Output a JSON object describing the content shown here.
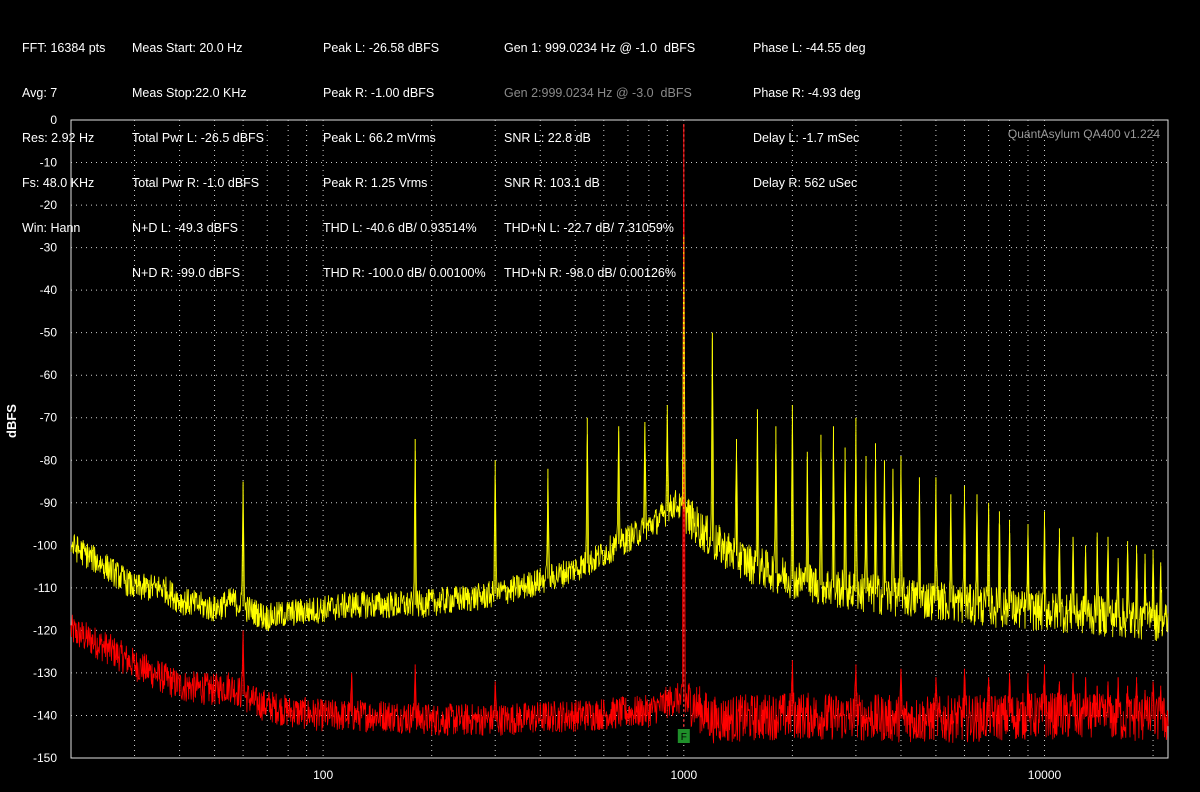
{
  "stats": {
    "col1": [
      "FFT: 16384 pts",
      "Avg: 7",
      "Res: 2.92 Hz",
      "Fs: 48.0 KHz",
      "Win: Hann"
    ],
    "col2": [
      "Meas Start: 20.0 Hz",
      "Meas Stop:22.0 KHz",
      "Total Pwr L: -26.5 dBFS",
      "Total Pwr R: -1.0 dBFS",
      "N+D L: -49.3 dBFS",
      "N+D R: -99.0 dBFS"
    ],
    "col3": [
      "Peak L: -26.58 dBFS",
      "Peak R: -1.00 dBFS",
      "Peak L: 66.2 mVrms",
      "Peak R: 1.25 Vrms",
      "THD L: -40.6 dB/ 0.93514%",
      "THD R: -100.0 dB/ 0.00100%"
    ],
    "col4_gen1": "Gen 1: 999.0234 Hz @ -1.0  dBFS",
    "col4_gen2": "Gen 2:999.0234 Hz @ -3.0  dBFS",
    "col4": [
      "SNR L: 22.8 dB",
      "SNR R: 103.1 dB",
      "THD+N L: -22.7 dB/ 7.31059%",
      "THD+N R: -98.0 dB/ 0.00126%"
    ],
    "col5": [
      "Phase L: -44.55 deg",
      "Phase R: -4.93 deg",
      "Delay L: -1.7 mSec",
      "Delay R: 562 uSec"
    ]
  },
  "chart_data": {
    "type": "line",
    "title": "",
    "watermark": "QuantAsylum QA400 v1.224",
    "xlabel": "",
    "ylabel": "dBFS",
    "x_scale": "log",
    "xlim": [
      20,
      22000
    ],
    "ylim": [
      -150,
      0
    ],
    "xticks": [
      100,
      1000,
      10000
    ],
    "xtick_labels": [
      "100",
      "1000",
      "10000"
    ],
    "yticks": [
      0,
      -10,
      -20,
      -30,
      -40,
      -50,
      -60,
      -70,
      -80,
      -90,
      -100,
      -110,
      -120,
      -130,
      -140,
      -150
    ],
    "grid": true,
    "fundamental_hz": 1000,
    "fundamental_marker": "F",
    "colors": {
      "left": "#ffff00",
      "right": "#ff0000",
      "background": "#000000",
      "grid": "#cfcfcf"
    },
    "series": [
      {
        "channel": "left",
        "floor": [
          [
            20,
            -100
          ],
          [
            25,
            -105
          ],
          [
            30,
            -110
          ],
          [
            36,
            -110
          ],
          [
            40,
            -113
          ],
          [
            45,
            -114
          ],
          [
            50,
            -115
          ],
          [
            56,
            -113
          ],
          [
            62,
            -115
          ],
          [
            70,
            -117
          ],
          [
            80,
            -116
          ],
          [
            100,
            -115
          ],
          [
            120,
            -114
          ],
          [
            150,
            -114
          ],
          [
            180,
            -114
          ],
          [
            220,
            -113
          ],
          [
            280,
            -112
          ],
          [
            350,
            -110
          ],
          [
            450,
            -107
          ],
          [
            550,
            -104
          ],
          [
            650,
            -100
          ],
          [
            750,
            -97
          ],
          [
            850,
            -94
          ],
          [
            950,
            -90
          ],
          [
            1050,
            -94
          ],
          [
            1200,
            -99
          ],
          [
            1500,
            -104
          ],
          [
            2000,
            -108
          ],
          [
            3000,
            -111
          ],
          [
            5000,
            -113
          ],
          [
            8000,
            -115
          ],
          [
            12000,
            -116
          ],
          [
            16000,
            -117
          ],
          [
            22000,
            -118
          ]
        ],
        "peaks": [
          [
            60,
            -85
          ],
          [
            180,
            -75
          ],
          [
            1000,
            -27
          ],
          [
            300,
            -80
          ],
          [
            420,
            -82
          ],
          [
            540,
            -70
          ],
          [
            660,
            -72
          ],
          [
            780,
            -71
          ],
          [
            900,
            -67
          ],
          [
            1200,
            -50
          ],
          [
            1400,
            -75
          ],
          [
            1600,
            -68
          ],
          [
            1800,
            -72
          ],
          [
            2000,
            -67
          ],
          [
            2200,
            -78
          ],
          [
            2400,
            -74
          ],
          [
            2600,
            -72
          ],
          [
            2800,
            -77
          ],
          [
            3000,
            -70
          ],
          [
            3200,
            -79
          ],
          [
            3400,
            -76
          ],
          [
            3600,
            -80
          ],
          [
            3800,
            -82
          ],
          [
            4000,
            -79
          ],
          [
            4500,
            -84
          ],
          [
            5000,
            -84
          ],
          [
            5500,
            -88
          ],
          [
            6000,
            -86
          ],
          [
            6500,
            -88
          ],
          [
            7000,
            -90
          ],
          [
            7500,
            -92
          ],
          [
            8000,
            -94
          ],
          [
            9000,
            -95
          ],
          [
            10000,
            -92
          ],
          [
            11000,
            -96
          ],
          [
            12000,
            -98
          ],
          [
            13000,
            -100
          ],
          [
            14000,
            -97
          ],
          [
            15000,
            -98
          ],
          [
            16000,
            -103
          ],
          [
            17000,
            -99
          ],
          [
            18000,
            -100
          ],
          [
            19000,
            -102
          ],
          [
            20000,
            -101
          ],
          [
            21000,
            -104
          ]
        ]
      },
      {
        "channel": "right",
        "floor": [
          [
            20,
            -120
          ],
          [
            25,
            -124
          ],
          [
            30,
            -128
          ],
          [
            40,
            -133
          ],
          [
            50,
            -134
          ],
          [
            55,
            -133
          ],
          [
            65,
            -137
          ],
          [
            80,
            -139
          ],
          [
            100,
            -140
          ],
          [
            150,
            -140
          ],
          [
            200,
            -141
          ],
          [
            300,
            -141
          ],
          [
            500,
            -140
          ],
          [
            800,
            -139
          ],
          [
            950,
            -136
          ],
          [
            1050,
            -137
          ],
          [
            1200,
            -141
          ],
          [
            2000,
            -140
          ],
          [
            5000,
            -141
          ],
          [
            10000,
            -140
          ],
          [
            22000,
            -141
          ]
        ],
        "peaks": [
          [
            60,
            -120
          ],
          [
            120,
            -130
          ],
          [
            180,
            -128
          ],
          [
            300,
            -132
          ],
          [
            1000,
            -1
          ],
          [
            2000,
            -127
          ],
          [
            3000,
            -128
          ],
          [
            4000,
            -129
          ],
          [
            5000,
            -131
          ],
          [
            6000,
            -129
          ],
          [
            7000,
            -131
          ],
          [
            8000,
            -130
          ],
          [
            9000,
            -130
          ],
          [
            10000,
            -128
          ],
          [
            11000,
            -132
          ],
          [
            12000,
            -130
          ],
          [
            13000,
            -131
          ],
          [
            14000,
            -133
          ],
          [
            15000,
            -132
          ],
          [
            16000,
            -131
          ],
          [
            17000,
            -133
          ],
          [
            18000,
            -131
          ],
          [
            19000,
            -134
          ],
          [
            20000,
            -132
          ],
          [
            21000,
            -133
          ]
        ]
      }
    ]
  }
}
